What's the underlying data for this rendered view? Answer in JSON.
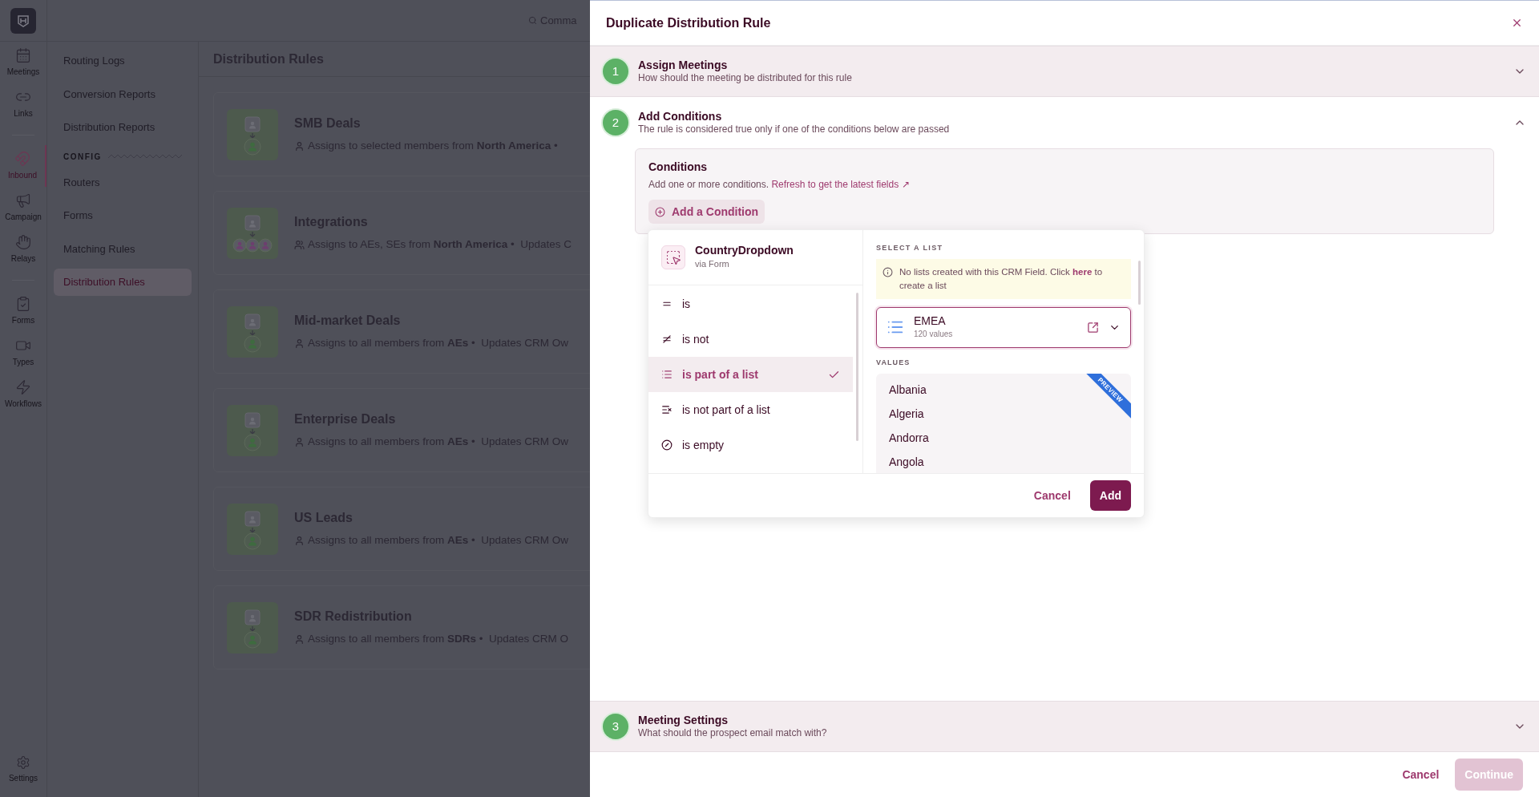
{
  "rail": {
    "items": [
      {
        "label": "Meetings",
        "kind": "calendar",
        "selected": false
      },
      {
        "label": "Links",
        "kind": "link",
        "selected": false
      },
      {
        "label": "Inbound",
        "kind": "magnet",
        "selected": true
      },
      {
        "label": "Campaign",
        "kind": "megaphone",
        "selected": false
      },
      {
        "label": "Relays",
        "kind": "hand",
        "selected": false
      },
      {
        "label": "Forms",
        "kind": "form",
        "selected": false
      },
      {
        "label": "Types",
        "kind": "video",
        "selected": false
      },
      {
        "label": "Workflows",
        "kind": "zap",
        "selected": false
      }
    ],
    "settings": "Settings"
  },
  "subnav": {
    "reports": [
      {
        "label": "Routing Logs",
        "selected": false
      },
      {
        "label": "Conversion Reports",
        "selected": false
      },
      {
        "label": "Distribution Reports",
        "selected": false
      }
    ],
    "config_heading": "CONFIG",
    "config": [
      {
        "label": "Routers",
        "selected": false
      },
      {
        "label": "Forms",
        "selected": false
      },
      {
        "label": "Matching Rules",
        "selected": false
      },
      {
        "label": "Distribution Rules",
        "selected": true
      }
    ]
  },
  "topbar": {
    "search_text": "Comma"
  },
  "page_title": "Distribution Rules",
  "rules": [
    {
      "name": "SMB Deals",
      "kind": "single",
      "description": "Assigns to selected members from **North America** •"
    },
    {
      "name": "Integrations",
      "kind": "team",
      "description": "Assigns to AEs, SEs from **North America** •  Updates C"
    },
    {
      "name": "Mid-market Deals",
      "kind": "single",
      "description": "Assigns to all members from **AEs** •  Updates CRM Ow"
    },
    {
      "name": "Enterprise Deals",
      "kind": "single",
      "description": "Assigns to all members from **AEs** •  Updates CRM Ow"
    },
    {
      "name": "US Leads",
      "kind": "single",
      "description": "Assigns to all members from **AEs** •  Updates CRM Ow"
    },
    {
      "name": "SDR Redistribution",
      "kind": "single",
      "description": "Assigns to all members from **SDRs** •  Updates CRM O"
    }
  ],
  "modal": {
    "title": "Duplicate Distribution Rule",
    "steps": [
      {
        "number": "1",
        "title": "Assign Meetings",
        "subtitle": "How should the meeting be distributed for this rule",
        "expanded": false
      },
      {
        "number": "2",
        "title": "Add Conditions",
        "subtitle": "The rule is considered true only if one of the conditions below are passed",
        "expanded": true
      },
      {
        "number": "3",
        "title": "Meeting Settings",
        "subtitle": "What should the prospect email match with?",
        "expanded": false
      }
    ],
    "conditions": {
      "title": "Conditions",
      "text": "Add one or more conditions.",
      "link": "Refresh to get the latest fields ↗",
      "add_button": "Add a Condition"
    },
    "popover": {
      "field": {
        "name": "CountryDropdown",
        "source": "via Form"
      },
      "operators": [
        {
          "kind": "equals",
          "label": "is",
          "selected": false
        },
        {
          "kind": "not_equals",
          "label": "is not",
          "selected": false
        },
        {
          "kind": "list",
          "label": "is part of a list",
          "selected": true
        },
        {
          "kind": "not_list",
          "label": "is not part of a list",
          "selected": false
        },
        {
          "kind": "empty",
          "label": "is empty",
          "selected": false
        }
      ],
      "select_heading": "SELECT A LIST",
      "notice": {
        "before": "No lists created with this CRM Field. Click",
        "link": "here",
        "after": "to create a list"
      },
      "list": {
        "value": "EMEA",
        "count": "120 values"
      },
      "values_heading": "VALUES",
      "ribbon": "PREVIEW",
      "values": [
        "Albania",
        "Algeria",
        "Andorra",
        "Angola"
      ],
      "cancel": "Cancel",
      "add": "Add"
    },
    "footer": {
      "cancel": "Cancel",
      "continue": "Continue",
      "continue_disabled": true
    }
  }
}
